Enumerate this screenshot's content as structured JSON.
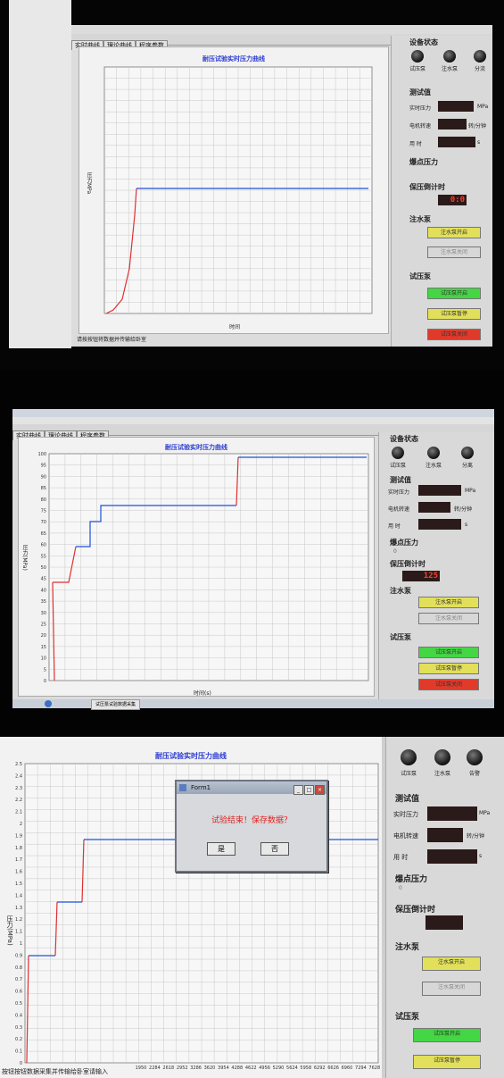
{
  "p1": {
    "tabs": [
      "实时曲线",
      "理论曲线",
      "程序参数"
    ],
    "chart_title": "耐压试验实时压力曲线",
    "xlabel": "时间",
    "ylabel": "压力MPa",
    "status": "请按按钮将数据并传输给卧室",
    "sections": {
      "device": "设备状态",
      "test": "测试值",
      "burst": "爆点压力",
      "hold": "保压倒计时",
      "water": "注水泵",
      "pressure": "试压泵"
    },
    "knobs": [
      "试压泵",
      "注水泵",
      "分流"
    ],
    "rows": [
      {
        "label": "实时压力",
        "value": "",
        "unit": "MPa"
      },
      {
        "label": "电机转速",
        "value": "",
        "unit": "转/分钟"
      },
      {
        "label": "用 时",
        "value": "",
        "unit": "s"
      }
    ],
    "hold_value": "0:0",
    "buttons": [
      "注水泵开启",
      "注水泵关闭",
      "试压泵开启",
      "试压泵暂停",
      "试压泵关闭"
    ]
  },
  "p2": {
    "tabs": [
      "实时曲线",
      "理论曲线",
      "程序参数"
    ],
    "chart_title": "耐压试验实时压力曲线",
    "xlabel": "时间(s)",
    "ylabel": "压力(MPa)",
    "yticks": [
      "100",
      "95",
      "90",
      "85",
      "80",
      "75",
      "70",
      "65",
      "60",
      "55",
      "50",
      "45",
      "40",
      "35",
      "30",
      "25",
      "20",
      "15",
      "10",
      "5",
      "0"
    ],
    "sections": {
      "device": "设备状态",
      "test": "测试值",
      "burst": "爆点压力",
      "hold": "保压倒计时",
      "water": "注水泵",
      "pressure": "试压泵"
    },
    "knobs": [
      "试压泵",
      "注水泵",
      "分离"
    ],
    "rows": [
      {
        "label": "实时压力",
        "value": "",
        "unit": "MPa"
      },
      {
        "label": "电机转速",
        "value": "",
        "unit": "转/分钟"
      },
      {
        "label": "用 时",
        "value": "",
        "unit": "s"
      }
    ],
    "burst_value": "0",
    "hold_value": "125",
    "buttons": [
      "注水泵开启",
      "注水泵关闭",
      "试压泵开启",
      "试压泵暂停",
      "试压泵关闭"
    ],
    "taskbar_item": "试压泵试验数据采集"
  },
  "p3": {
    "chart_title": "耐压试验实时压力曲线",
    "ylabel": "压力(MPa)",
    "yticks": [
      "2.5",
      "2.4",
      "2.3",
      "2.2",
      "2.1",
      "2",
      "1.9",
      "1.8",
      "1.7",
      "1.6",
      "1.5",
      "1.4",
      "1.3",
      "1.2",
      "1.1",
      "1",
      "0.9",
      "0.8",
      "0.7",
      "0.6",
      "0.5",
      "0.4",
      "0.3",
      "0.2",
      "0.1",
      "0"
    ],
    "xticks": [
      "1950",
      "2284",
      "2618",
      "2952",
      "3286",
      "3620",
      "3954",
      "4288",
      "4622",
      "4956",
      "5290",
      "5624",
      "5958",
      "6292",
      "6626",
      "6960",
      "7294",
      "7628"
    ],
    "status": "按钮按钮数据采集并传输给卧室请输入",
    "sections": {
      "test": "测试值",
      "burst": "爆点压力",
      "hold": "保压倒计时",
      "water": "注水泵",
      "pressure": "试压泵"
    },
    "knobs": [
      "试压泵",
      "注水泵",
      "告警"
    ],
    "rows": [
      {
        "label": "实时压力",
        "value": "",
        "unit": "MPa"
      },
      {
        "label": "电机转速",
        "value": "",
        "unit": "转/分钟"
      },
      {
        "label": "用 时",
        "value": "",
        "unit": "s"
      }
    ],
    "burst_value": "0",
    "buttons": [
      "注水泵开启",
      "注水泵关闭",
      "试压泵开启",
      "试压泵暂停"
    ],
    "dialog": {
      "title": "Form1",
      "message": "试验结束！保存数据？",
      "yes": "是",
      "no": "否"
    }
  },
  "colors": {
    "curve_blue": "#2050d8",
    "curve_red": "#e03030",
    "btn_yellow": "#e2e05a",
    "btn_green": "#44d644",
    "btn_red": "#e03a2a"
  }
}
